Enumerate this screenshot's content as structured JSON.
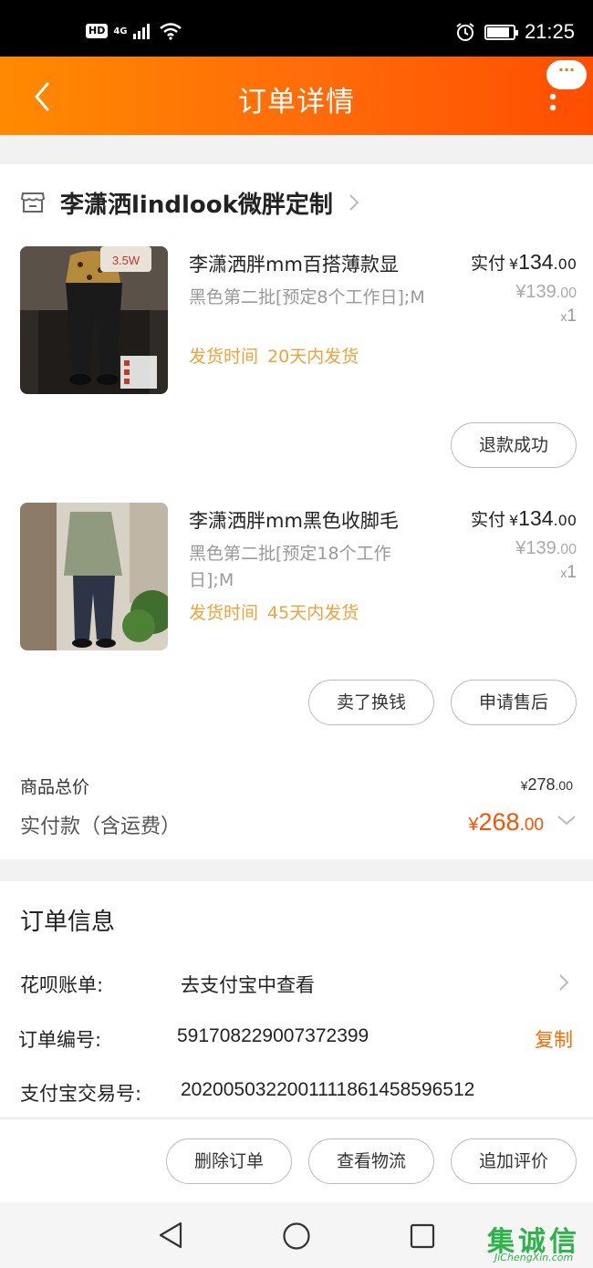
{
  "status_bar": {
    "hd": "HD",
    "network": "4G",
    "time": "21:25",
    "battery_level": 0.85,
    "icons": [
      "hd-icon",
      "signal-icon",
      "wifi-icon",
      "alarm-icon",
      "battery-icon"
    ]
  },
  "nav": {
    "title": "订单详情",
    "more_badge": "···",
    "icons": [
      "back-icon",
      "more-icon",
      "message-icon"
    ]
  },
  "shop": {
    "name": "李潇洒lindlook微胖定制",
    "icon": "store-icon"
  },
  "items": [
    {
      "title": "李潇洒胖mm百搭薄款显",
      "sku": "黑色第二批[预定8个工作日];M",
      "ship_label": "发货时间",
      "ship_value": "20天内发货",
      "paid_label": "实付",
      "paid_currency": "¥",
      "paid_int": "134",
      "paid_dec": ".00",
      "orig_price": "¥139",
      "orig_dec": ".00",
      "qty_x": "x",
      "qty": "1",
      "image_badge": "3.5W",
      "buttons": [
        "退款成功"
      ]
    },
    {
      "title": "李潇洒胖mm黑色收脚毛",
      "sku": "黑色第二批[预定18个工作日];M",
      "ship_label": "发货时间",
      "ship_value": "45天内发货",
      "paid_label": "实付",
      "paid_currency": "¥",
      "paid_int": "134",
      "paid_dec": ".00",
      "orig_price": "¥139",
      "orig_dec": ".00",
      "qty_x": "x",
      "qty": "1",
      "buttons": [
        "卖了换钱",
        "申请售后"
      ]
    }
  ],
  "summary": {
    "goods_total_label": "商品总价",
    "goods_total_currency": "¥",
    "goods_total_int": "278",
    "goods_total_dec": ".00",
    "paid_label": "实付款（含运费）",
    "paid_currency": "¥",
    "paid_int": "268",
    "paid_dec": ".00"
  },
  "order_info": {
    "title": "订单信息",
    "huabei_label": "花呗账单:",
    "huabei_value": "去支付宝中查看",
    "order_no_label": "订单编号:",
    "order_no_value": "591708229007372399",
    "copy_label": "复制",
    "alipay_no_label": "支付宝交易号:",
    "alipay_no_value": "2020050322001111861458596512"
  },
  "bottom_actions": [
    "删除订单",
    "查看物流",
    "追加评价"
  ],
  "watermark": {
    "glyphs": "集诚信",
    "url": "JiChengXin.com"
  },
  "colors": {
    "accent": "#ff6a00",
    "price_red": "#ff5000",
    "ship_yellow": "#f0a23b",
    "nav_start": "#ff8a00",
    "nav_end": "#ff4e00"
  }
}
